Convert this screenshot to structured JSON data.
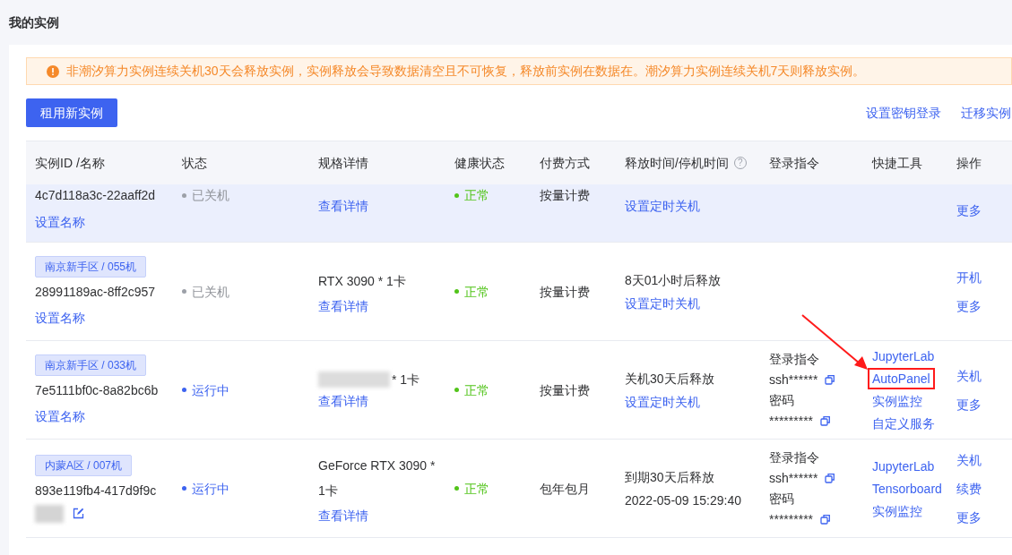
{
  "page_title": "我的实例",
  "notice": "非潮汐算力实例连续关机30天会释放实例，实例释放会导致数据清空且不可恢复，释放前实例在数据在。潮汐算力实例连续关机7天则释放实例。",
  "primary_button": "租用新实例",
  "toolbar_links": [
    "设置密钥登录",
    "迁移实例"
  ],
  "table": {
    "columns": [
      {
        "label": "实例ID /名称"
      },
      {
        "label": "状态"
      },
      {
        "label": "规格详情"
      },
      {
        "label": "健康状态"
      },
      {
        "label": "付费方式"
      },
      {
        "label": "释放时间/停机时间",
        "help_icon": "?"
      },
      {
        "label": "登录指令"
      },
      {
        "label": "快捷工具"
      },
      {
        "label": "操作"
      }
    ],
    "rows": [
      {
        "clipped": true,
        "selected": true,
        "id": "4c7d118a3c-22aaff2d",
        "name_link": "设置名称",
        "status": {
          "kind": "stopped",
          "text": "已关机"
        },
        "detail_link": "查看详情",
        "health": "正常",
        "billing": "按量计费",
        "release": {
          "link": "设置定时关机"
        },
        "actions": [
          "更多"
        ]
      },
      {
        "clipped": false,
        "selected": false,
        "tag": "南京新手区 / 055机",
        "id": "28991189ac-8ff2c957",
        "name_link": "设置名称",
        "status": {
          "kind": "stopped",
          "text": "已关机"
        },
        "spec": "RTX 3090 * 1卡",
        "detail_link": "查看详情",
        "health": "正常",
        "billing": "按量计费",
        "release": {
          "text": "8天01小时后释放",
          "link": "设置定时关机"
        },
        "actions": [
          "开机",
          "更多"
        ]
      },
      {
        "clipped": false,
        "selected": false,
        "tag": "南京新手区 / 033机",
        "id": "7e5111bf0c-8a82bc6b",
        "name_link": "设置名称",
        "status": {
          "kind": "running",
          "text": "运行中"
        },
        "spec": "* 1卡",
        "spec_redacted": true,
        "detail_link": "查看详情",
        "health": "正常",
        "billing": "按量计费",
        "release": {
          "text": "关机30天后释放",
          "link": "设置定时关机"
        },
        "login": {
          "label": "登录指令",
          "command": "ssh******",
          "password_label": "密码",
          "password": "*********"
        },
        "tools": [
          {
            "text": "JupyterLab",
            "highlighted": false
          },
          {
            "text": "AutoPanel",
            "highlighted": true
          },
          {
            "text": "实例监控",
            "highlighted": false
          },
          {
            "text": "自定义服务",
            "highlighted": false
          }
        ],
        "actions": [
          "关机",
          "更多"
        ]
      },
      {
        "clipped": false,
        "selected": false,
        "tag": "内蒙A区 / 007机",
        "id": "893e119fb4-417d9f9c",
        "name_redacted": true,
        "status": {
          "kind": "running",
          "text": "运行中"
        },
        "spec": "GeForce RTX 3090 * 1卡",
        "detail_link": "查看详情",
        "health": "正常",
        "billing": "包年包月",
        "release": {
          "text": "到期30天后释放",
          "time": "2022-05-09 15:29:40"
        },
        "login": {
          "label": "登录指令",
          "command": "ssh******",
          "password_label": "密码",
          "password": "*********"
        },
        "tools": [
          {
            "text": "JupyterLab",
            "highlighted": false
          },
          {
            "text": "Tensorboard",
            "highlighted": false
          },
          {
            "text": "实例监控",
            "highlighted": false
          }
        ],
        "actions": [
          "关机",
          "续费",
          "更多"
        ]
      }
    ]
  }
}
